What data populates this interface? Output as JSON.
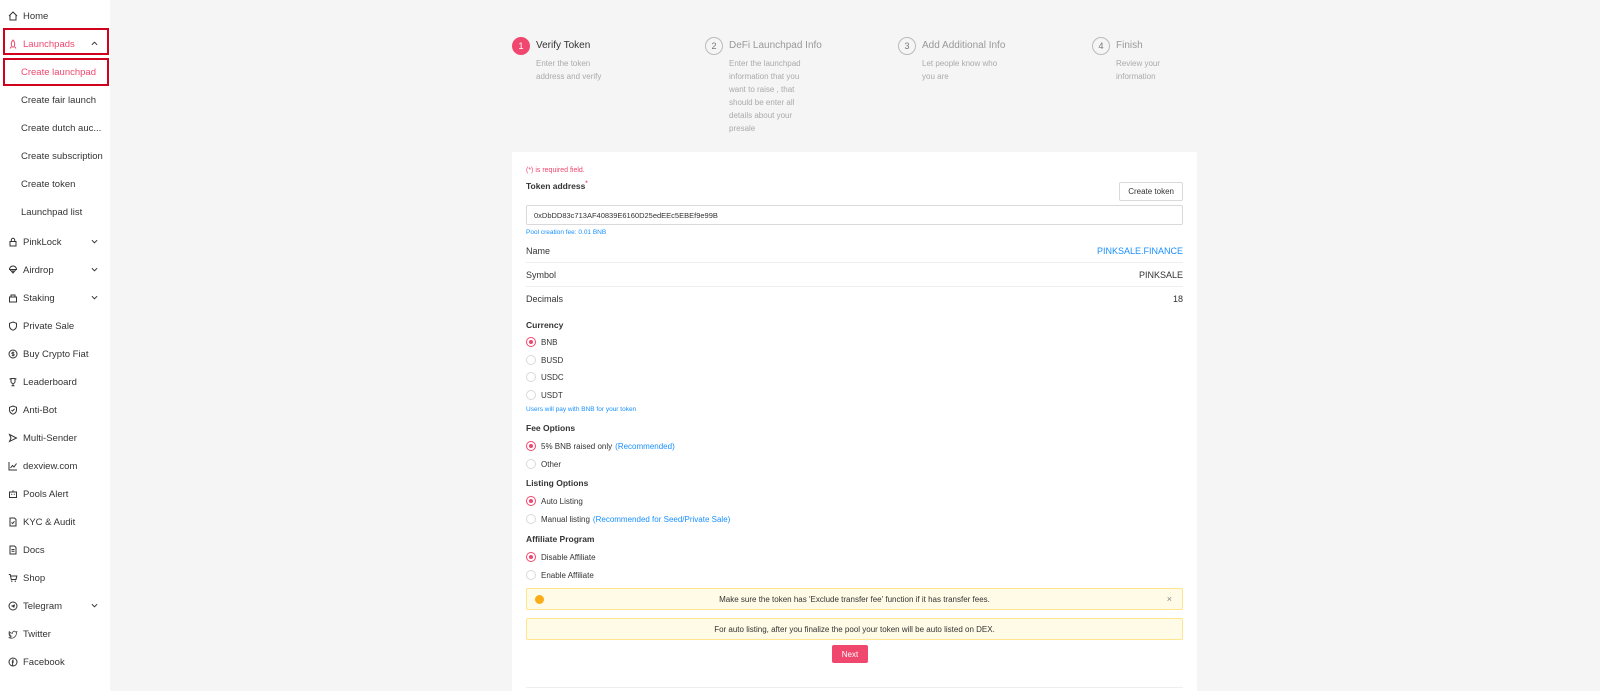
{
  "sidebar": {
    "home": "Home",
    "launchpads": "Launchpads",
    "sub": [
      "Create launchpad",
      "Create fair launch",
      "Create dutch auc...",
      "Create subscription",
      "Create token",
      "Launchpad list"
    ],
    "items": [
      "PinkLock",
      "Airdrop",
      "Staking",
      "Private Sale",
      "Buy Crypto Fiat",
      "Leaderboard",
      "Anti-Bot",
      "Multi-Sender",
      "dexview.com",
      "Pools Alert",
      "KYC & Audit",
      "Docs",
      "Shop",
      "Telegram",
      "Twitter",
      "Facebook"
    ]
  },
  "steps": [
    {
      "num": "1",
      "title": "Verify Token",
      "desc": "Enter the token address and verify"
    },
    {
      "num": "2",
      "title": "DeFi Launchpad Info",
      "desc": "Enter the launchpad information that you want to raise , that should be enter all details about your presale"
    },
    {
      "num": "3",
      "title": "Add Additional Info",
      "desc": "Let people know who you are"
    },
    {
      "num": "4",
      "title": "Finish",
      "desc": "Review your information"
    }
  ],
  "form": {
    "required_note": "(*) is required field.",
    "token_address_label": "Token address",
    "required_mark": "*",
    "create_token_button": "Create token",
    "token_address_value": "0xDbDD83c713AF40839E6160D25edEEc5EBEf9e99B",
    "pool_fee_hint": "Pool creation fee: 0.01 BNB",
    "name_label": "Name",
    "name_value": "PINKSALE.FINANCE",
    "symbol_label": "Symbol",
    "symbol_value": "PINKSALE",
    "decimals_label": "Decimals",
    "decimals_value": "18",
    "currency_label": "Currency",
    "currency_options": [
      "BNB",
      "BUSD",
      "USDC",
      "USDT"
    ],
    "currency_selected": "BNB",
    "currency_hint": "Users will pay with BNB for your token",
    "fee_label": "Fee Options",
    "fee_option_1": "5% BNB raised only",
    "fee_option_1_rec": "(Recommended)",
    "fee_option_2": "Other",
    "listing_label": "Listing Options",
    "listing_option_1": "Auto Listing",
    "listing_option_2": "Manual listing",
    "listing_option_2_rec": "(Recommended for Seed/Private Sale)",
    "affiliate_label": "Affiliate Program",
    "affiliate_option_1": "Disable Affiliate",
    "affiliate_option_2": "Enable Affiliate",
    "alert_warning": "Make sure the token has 'Exclude transfer fee' function if it has transfer fees.",
    "alert_close": "×",
    "alert_info": "For auto listing, after you finalize the pool your token will be auto listed on DEX.",
    "next_button": "Next"
  },
  "colors": {
    "accent": "#f0476f",
    "link": "#1890ff",
    "highlight_box": "#d0021b"
  }
}
